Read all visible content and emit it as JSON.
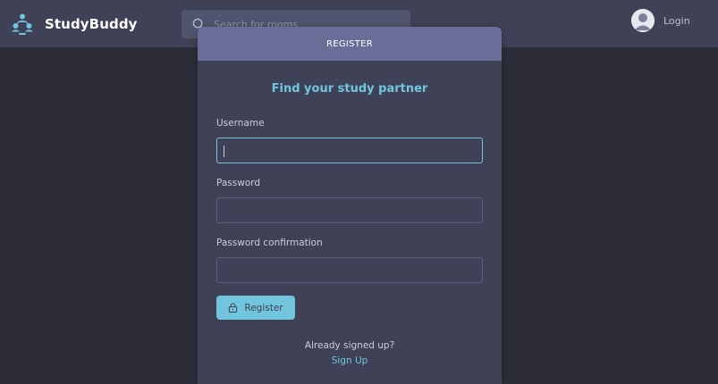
{
  "app": {
    "name": "StudyBuddy",
    "logo_icon": "network-people-icon"
  },
  "header": {
    "search": {
      "placeholder": "Search for rooms...",
      "icon": "search-icon"
    },
    "user": {
      "avatar_icon": "user-avatar-icon",
      "login_label": "Login"
    }
  },
  "register_card": {
    "header_label": "REGISTER",
    "title": "Find your study partner",
    "fields": {
      "username": {
        "label": "Username",
        "value": ""
      },
      "password": {
        "label": "Password",
        "value": ""
      },
      "password_confirmation": {
        "label": "Password confirmation",
        "value": ""
      }
    },
    "submit": {
      "label": "Register",
      "icon": "lock-icon"
    },
    "footer": {
      "note": "Already signed up?",
      "link_label": "Sign Up"
    }
  },
  "colors": {
    "background": "#2d2d39",
    "topbar": "#3f4156",
    "card": "#3f4156",
    "card_header": "#696d97",
    "accent": "#71c6dd",
    "text": "#c9cfdd"
  }
}
